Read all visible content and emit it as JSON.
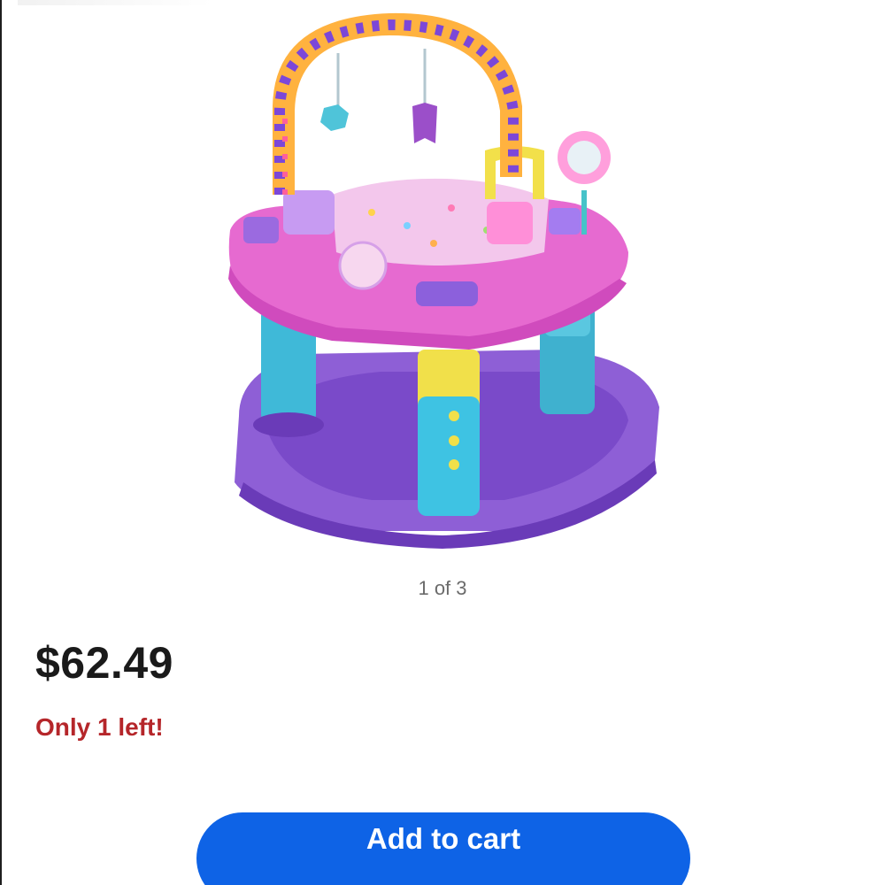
{
  "product": {
    "image_alt_name": "activity-center",
    "image_counter": "1 of 3",
    "price": "$62.49",
    "stock_note": "Only 1 left!"
  },
  "actions": {
    "add_to_cart_label": "Add to cart"
  },
  "colors": {
    "price_text": "#1a1a1a",
    "stock_note_text": "#b5262a",
    "cart_button_bg": "#0e63e6",
    "cart_button_text": "#ffffff",
    "counter_text": "#6b6b6b"
  }
}
